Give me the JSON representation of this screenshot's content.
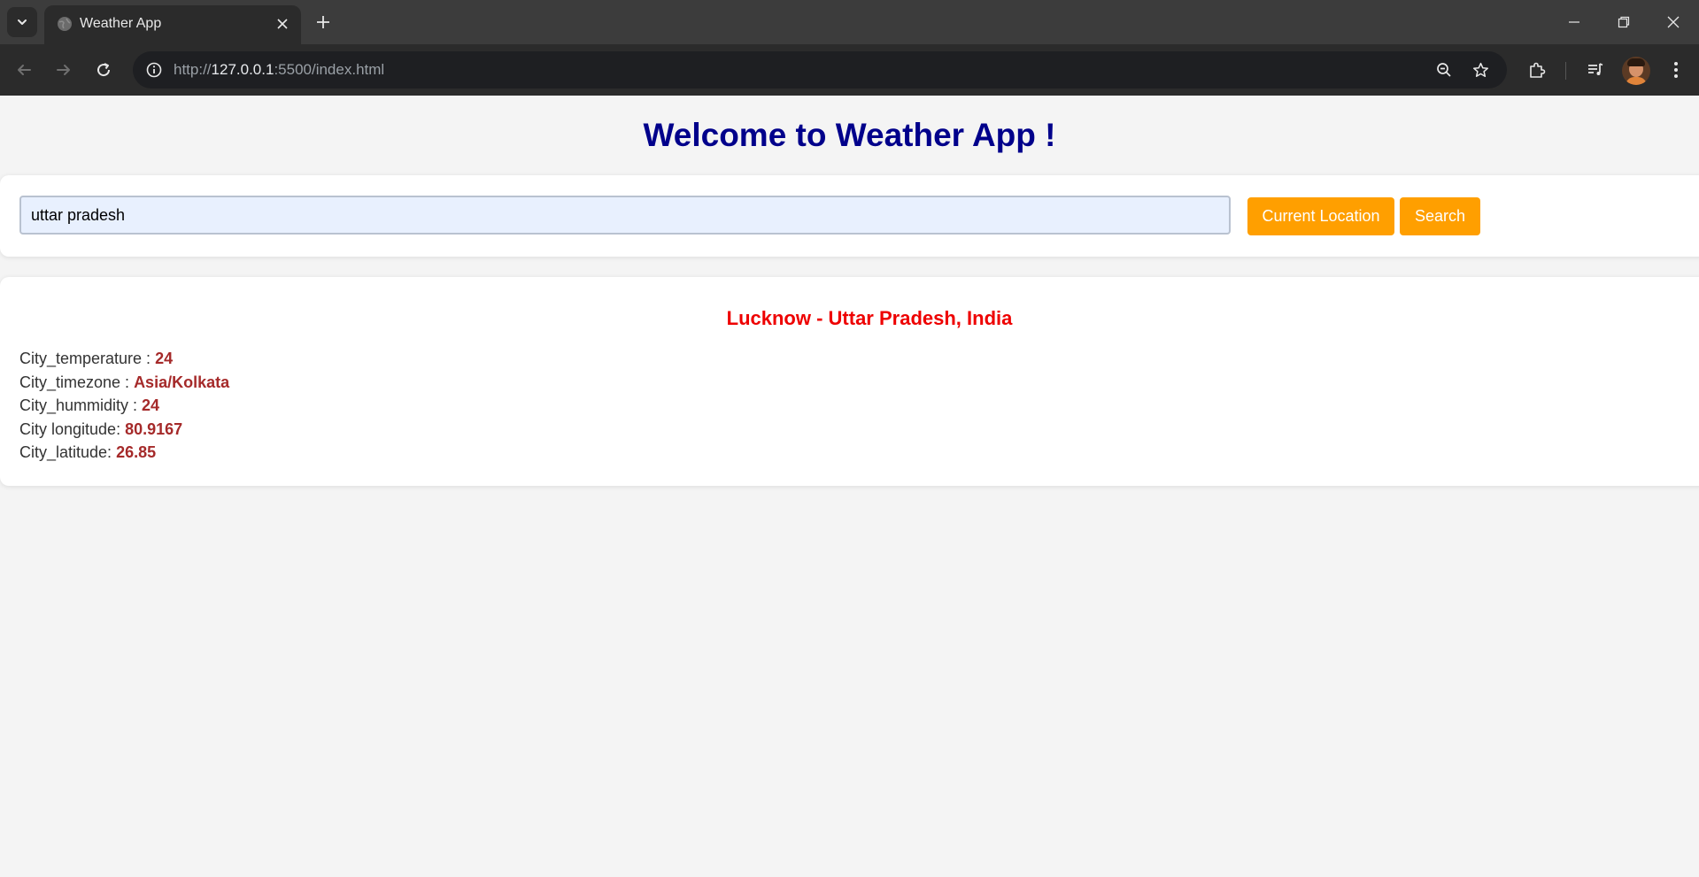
{
  "browser": {
    "tab_title": "Weather App",
    "url_scheme": "http://",
    "url_host": "127.0.0.1",
    "url_rest": ":5500/index.html"
  },
  "page": {
    "title": "Welcome to Weather App !",
    "search": {
      "value": "uttar pradesh",
      "current_location_label": "Current Location",
      "search_label": "Search"
    },
    "result": {
      "heading": "Lucknow - Uttar Pradesh, India",
      "fields": [
        {
          "label": "City_temperature : ",
          "value": "24"
        },
        {
          "label": "City_timezone : ",
          "value": "Asia/Kolkata"
        },
        {
          "label": "City_hummidity : ",
          "value": "24"
        },
        {
          "label": "City longitude: ",
          "value": "80.9167"
        },
        {
          "label": "City_latitude: ",
          "value": "26.85"
        }
      ]
    }
  },
  "colors": {
    "title": "#00008b",
    "button": "#ff9f00",
    "heading": "#ee0000",
    "value": "#a52a2a"
  }
}
